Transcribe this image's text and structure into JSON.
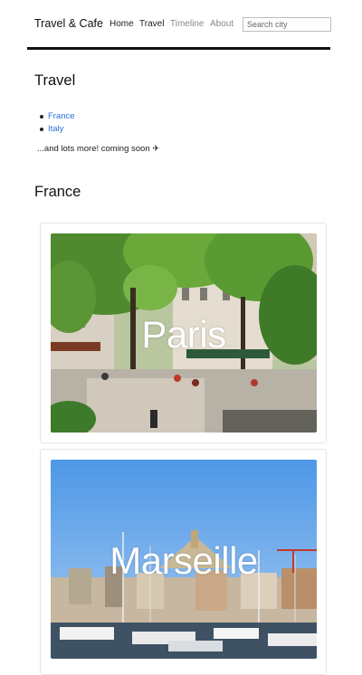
{
  "header": {
    "brand": "Travel & Cafe",
    "nav": [
      {
        "label": "Home",
        "active": true
      },
      {
        "label": "Travel",
        "active": true
      },
      {
        "label": "Timeline",
        "active": false
      },
      {
        "label": "About",
        "active": false
      }
    ],
    "search_placeholder": "Search city"
  },
  "main": {
    "heading": "Travel",
    "links": [
      "France",
      "Italy"
    ],
    "note": "...and lots more! coming soon ✈",
    "section_heading": "France",
    "cards": [
      {
        "title": "Paris"
      },
      {
        "title": "Marseille"
      }
    ]
  },
  "colors": {
    "link": "#2a6fd6",
    "muted_nav": "#888888",
    "rule": "#111111"
  }
}
